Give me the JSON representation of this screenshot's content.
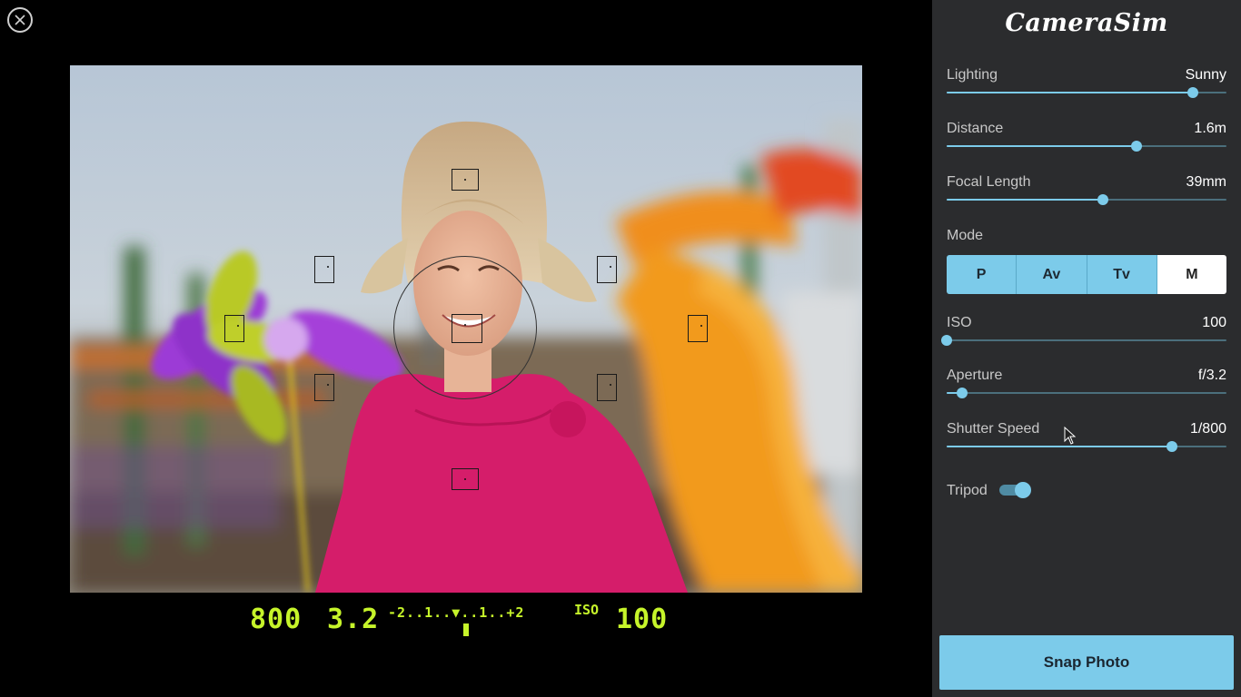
{
  "app": {
    "brand": "CameraSim"
  },
  "controls": {
    "lighting": {
      "label": "Lighting",
      "value": "Sunny",
      "level": 0.88
    },
    "distance": {
      "label": "Distance",
      "value": "1.6m",
      "level": 0.68
    },
    "focal_length": {
      "label": "Focal Length",
      "value": "39mm",
      "level": 0.56
    },
    "iso": {
      "label": "ISO",
      "value": "100",
      "level": 0.0
    },
    "aperture": {
      "label": "Aperture",
      "value": "f/3.2",
      "level": 0.055
    },
    "shutter_speed": {
      "label": "Shutter Speed",
      "value": "1/800",
      "level": 0.805
    }
  },
  "mode": {
    "label": "Mode",
    "options": [
      "P",
      "Av",
      "Tv",
      "M"
    ],
    "selected": "M"
  },
  "tripod": {
    "label": "Tripod",
    "on": true
  },
  "snap_label": "Snap Photo",
  "viewfinder": {
    "shutter": "800",
    "aperture": "3.2",
    "exposure_scale": "-2..1..▼..1..+2",
    "iso_label": "ISO",
    "iso": "100"
  },
  "colors": {
    "accent": "#7ccbea",
    "panel_bg": "#2b2c2e",
    "lcd_green": "#c6f42a"
  }
}
